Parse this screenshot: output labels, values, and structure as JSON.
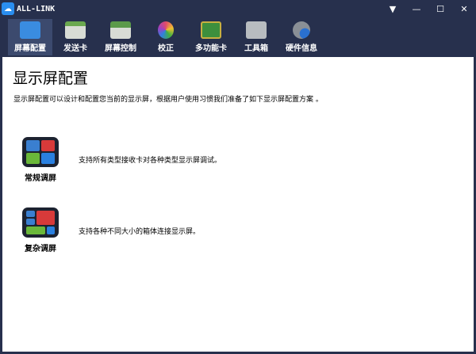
{
  "app": {
    "title": "ALL-LINK"
  },
  "window": {
    "buttons": [
      "▼",
      "—",
      "☐",
      "✕"
    ]
  },
  "toolbar": [
    {
      "label": "屏幕配置",
      "icon": "monitor-gear-icon",
      "color": "#3a8ce0",
      "active": true
    },
    {
      "label": "发送卡",
      "icon": "sender-card-icon",
      "color": "#6aa84f"
    },
    {
      "label": "屏幕控制",
      "icon": "screen-control-icon",
      "color": "#5b9a4a"
    },
    {
      "label": "校正",
      "icon": "color-wheel-icon",
      "color": "#e04b6a"
    },
    {
      "label": "多功能卡",
      "icon": "circuit-board-icon",
      "color": "#3d8f3d"
    },
    {
      "label": "工具箱",
      "icon": "toolbox-icon",
      "color": "#9aa0a6"
    },
    {
      "label": "硬件信息",
      "icon": "gear-info-icon",
      "color": "#8a8f96"
    }
  ],
  "main": {
    "title": "显示屏配置",
    "description": "显示屏配置可以设计和配置您当前的显示屏，根据用户使用习惯我们准备了如下显示屏配置方案 。",
    "modes": [
      {
        "label": "常规调屏",
        "description": "支持所有类型接收卡对各种类型显示屏调试。"
      },
      {
        "label": "复杂调屏",
        "description": "支持各种不同大小的箱体连接显示屏。"
      }
    ]
  }
}
